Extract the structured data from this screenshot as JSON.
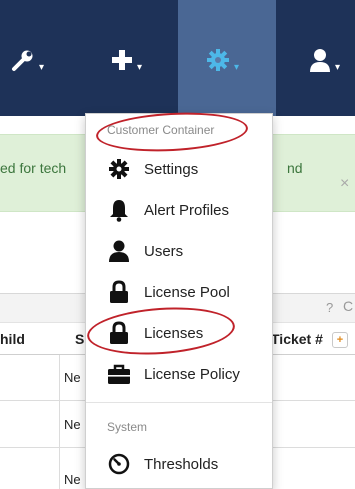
{
  "navbar": {
    "tools_caret": "▾",
    "add_caret": "▾",
    "gear_caret": "▾",
    "user_caret": "▾"
  },
  "notice": {
    "text_left": "ed for tech",
    "text_right": "nd",
    "close": "×"
  },
  "toolbar": {
    "help": "?",
    "refresh": "C"
  },
  "table": {
    "headers": [
      "hild",
      "S",
      "Ticket #"
    ],
    "add_column": "+",
    "rows": [
      {
        "status": "Ne"
      },
      {
        "status": "Ne"
      },
      {
        "status": "Ne"
      }
    ]
  },
  "menu": {
    "section1_header": "Customer Container",
    "section1_items": [
      {
        "label": "Settings",
        "icon": "gear-icon"
      },
      {
        "label": "Alert Profiles",
        "icon": "bell-icon"
      },
      {
        "label": "Users",
        "icon": "user-icon"
      },
      {
        "label": "License Pool",
        "icon": "lock-icon"
      },
      {
        "label": "Licenses",
        "icon": "lock-icon"
      },
      {
        "label": "License Policy",
        "icon": "briefcase-icon"
      }
    ],
    "section2_header": "System",
    "section2_items": [
      {
        "label": "Thresholds",
        "icon": "gauge-icon"
      }
    ]
  },
  "annotations": {
    "highlight_color": "#c0222a"
  },
  "colors": {
    "navbar": "#1e3258",
    "active_tab": "#5a7aa8",
    "gear_icon": "#4db8e8",
    "notice_bg": "#dff0d8",
    "notice_text": "#3c763d"
  }
}
